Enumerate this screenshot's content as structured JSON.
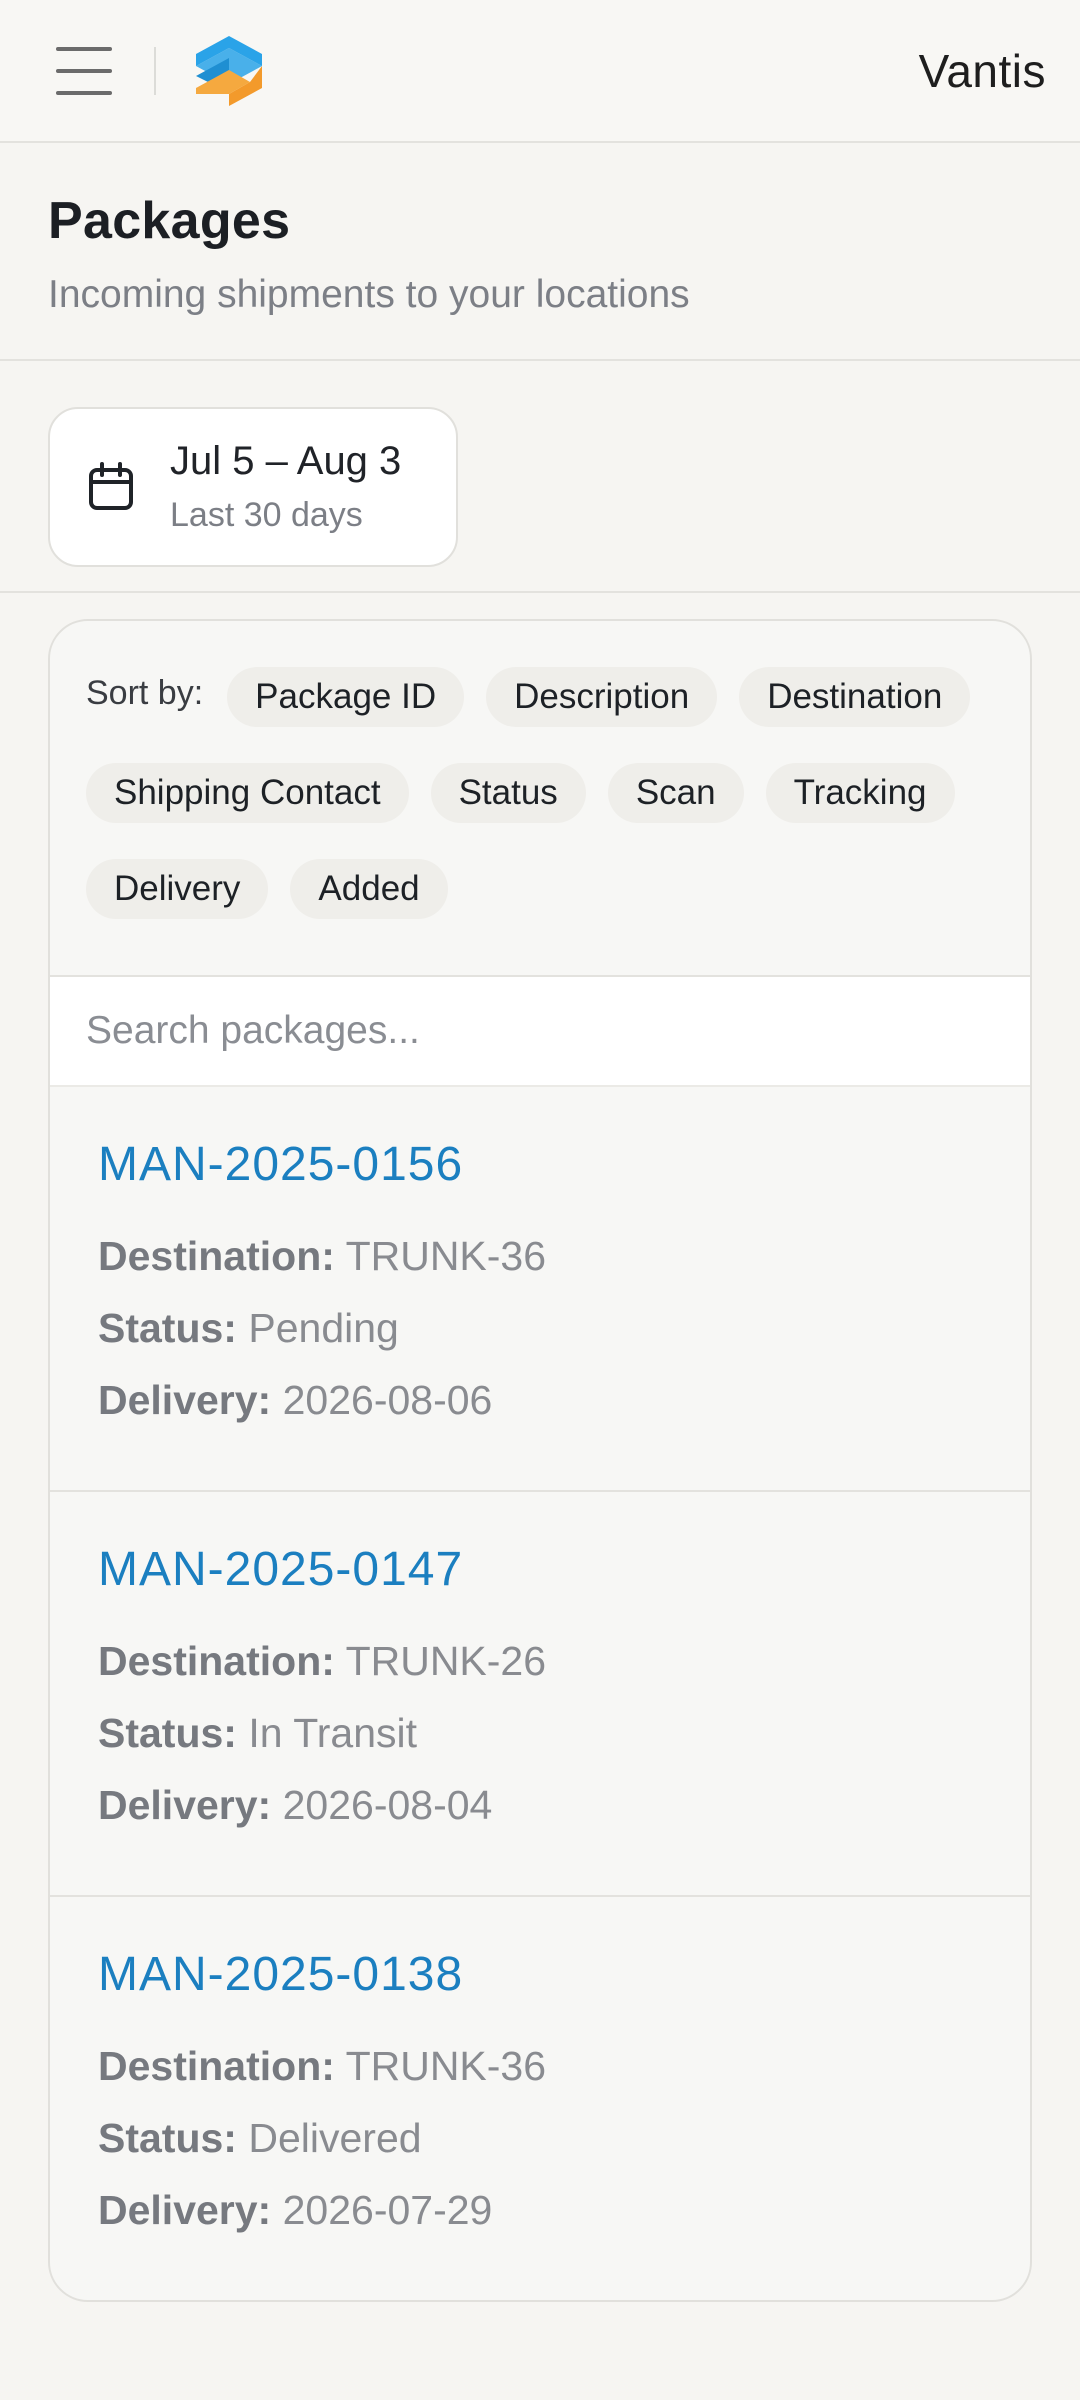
{
  "app": {
    "brand": "Vantis",
    "logo_colors": [
      "#2aa3e8",
      "#f39a2b"
    ]
  },
  "header": {
    "title": "Packages",
    "subtitle": "Incoming shipments to your locations"
  },
  "date_range": {
    "range": "Jul 5 – Aug 3",
    "label": "Last 30 days",
    "icon": "calendar-icon"
  },
  "sort": {
    "label": "Sort by:",
    "options": [
      "Package ID",
      "Description",
      "Destination",
      "Shipping Contact",
      "Status",
      "Scan",
      "Tracking",
      "Delivery",
      "Added"
    ]
  },
  "search": {
    "placeholder": "Search packages...",
    "value": ""
  },
  "field_labels": {
    "destination": "Destination:",
    "status": "Status:",
    "delivery": "Delivery:"
  },
  "packages": [
    {
      "id": "MAN-2025-0156",
      "destination": "TRUNK-36",
      "status": "Pending",
      "delivery": "2026-08-06"
    },
    {
      "id": "MAN-2025-0147",
      "destination": "TRUNK-26",
      "status": "In Transit",
      "delivery": "2026-08-04"
    },
    {
      "id": "MAN-2025-0138",
      "destination": "TRUNK-36",
      "status": "Delivered",
      "delivery": "2026-07-29"
    }
  ],
  "colors": {
    "accent": "#1b7fc0",
    "background": "#f6f5f2"
  }
}
